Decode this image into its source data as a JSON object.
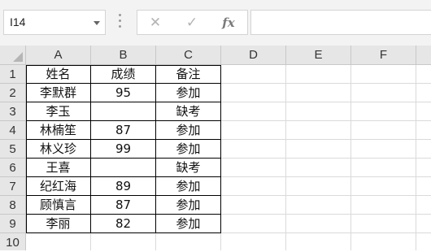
{
  "toolbar": {
    "name_box": "I14",
    "cancel_icon": "✕",
    "enter_icon": "✓",
    "fx_label": "fx",
    "formula_value": ""
  },
  "columns": [
    "A",
    "B",
    "C",
    "D",
    "E",
    "F"
  ],
  "rows": [
    {
      "num": "1",
      "a": "姓名",
      "b": "成绩",
      "c": "备注"
    },
    {
      "num": "2",
      "a": "李默群",
      "b": "95",
      "c": "参加"
    },
    {
      "num": "3",
      "a": "李玉",
      "b": "",
      "c": "缺考"
    },
    {
      "num": "4",
      "a": "林楠笙",
      "b": "87",
      "c": "参加"
    },
    {
      "num": "5",
      "a": "林义珍",
      "b": "99",
      "c": "参加"
    },
    {
      "num": "6",
      "a": "王喜",
      "b": "",
      "c": "缺考"
    },
    {
      "num": "7",
      "a": "纪红海",
      "b": "89",
      "c": "参加"
    },
    {
      "num": "8",
      "a": "顾慎言",
      "b": "87",
      "c": "参加"
    },
    {
      "num": "9",
      "a": "李丽",
      "b": "82",
      "c": "参加"
    },
    {
      "num": "10",
      "a": "",
      "b": "",
      "c": ""
    }
  ]
}
